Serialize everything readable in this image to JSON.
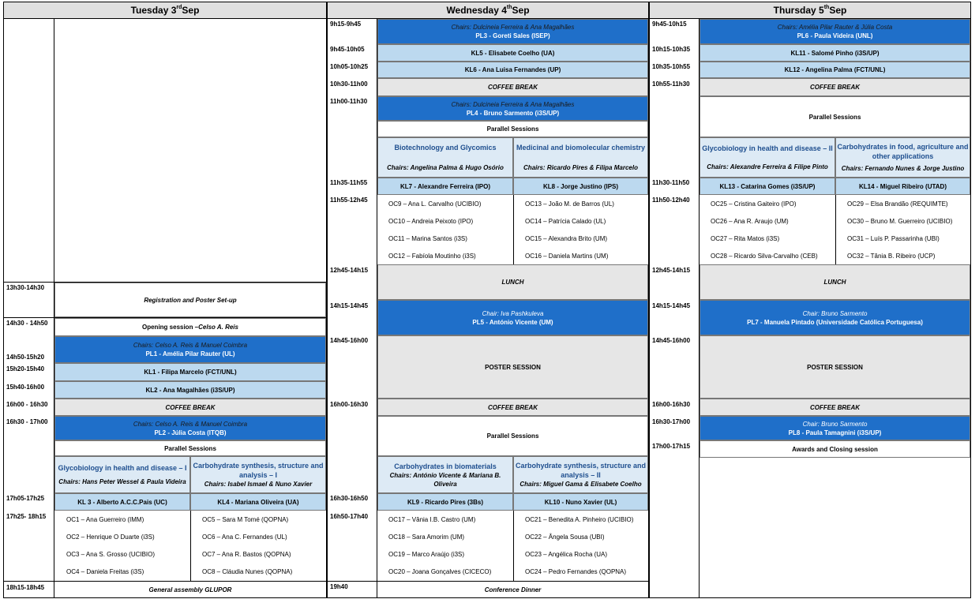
{
  "days": [
    {
      "name": "Tuesday 3",
      "sup": "rd",
      "rest": " Sep"
    },
    {
      "name": "Wednesday 4",
      "sup": "th",
      "rest": " Sep"
    },
    {
      "name": "Thursday 5",
      "sup": "th",
      "rest": " Sep"
    }
  ],
  "tue": {
    "times": [
      "13h30-14h30",
      "14h30 - 14h50",
      "14h50-15h20",
      "15h20-15h40",
      "15h40-16h00",
      "16h00 - 16h30",
      "16h30 - 17h00",
      "17h05-17h25",
      "17h25- 18h15",
      "18h15-18h45"
    ],
    "registration": "Registration and Poster Set-up",
    "opening_a": "Opening session – ",
    "opening_b": "Celso A. Reis",
    "pl1_chairs": "Chairs: Celso A. Reis & Manuel Coimbra",
    "pl1": "PL1 - Amélia Pilar Rauter (UL)",
    "kl1": "KL1 - Filipa Marcelo (FCT/UNL)",
    "kl2": "KL2 - Ana Magalhães (i3S/UP)",
    "coffee": "COFFEE BREAK",
    "pl2_chairs": "Chairs: Celso A. Reis & Manuel Coimbra",
    "pl2": "PL2 - Júlia Costa (ITQB)",
    "parallel": "Parallel Sessions",
    "s1_title": "Glycobiology in health and disease – I",
    "s1_chairs": "Chairs: Hans Peter Wessel & Paula Videira",
    "s2_title": "Carbohydrate synthesis, structure and analysis – I",
    "s2_chairs": "Chairs: Isabel Ismael & Nuno Xavier",
    "kl3": "KL 3 - Alberto A.C.C.Pais (UC)",
    "kl4": "KL4 - Mariana Oliveira (UA)",
    "oc_left": [
      "OC1 – Ana Guerreiro (IMM)",
      "OC2 – Henrique O Duarte (i3S)",
      "OC3 – Ana S. Grosso (UCIBIO)",
      "OC4 – Daniela Freitas (i3S)"
    ],
    "oc_right": [
      "OC5 – Sara M Tomé (QOPNA)",
      "OC6 – Ana C. Fernandes (UL)",
      "OC7 – Ana R. Bastos (QOPNA)",
      "OC8 – Cláudia Nunes (QOPNA)"
    ],
    "assembly": "General assembly GLUPOR"
  },
  "wed": {
    "times": [
      "9h15-9h45",
      "9h45-10h05",
      "10h05-10h25",
      "10h30-11h00",
      "11h00-11h30",
      "11h35-11h55",
      "11h55-12h45",
      "12h45-14h15",
      "14h15-14h45",
      "14h45-16h00",
      "16h00-16h30",
      "16h30-16h50",
      "16h50-17h40",
      "19h40"
    ],
    "pl3_chairs": "Chairs: Dulcineia Ferreira & Ana Magalhães",
    "pl3": "PL3 -  Goreti Sales (ISEP)",
    "kl5": "KL5 - Elisabete Coelho (UA)",
    "kl6": "KL6 - Ana Luisa Fernandes (UP)",
    "coffee": "COFFEE BREAK",
    "pl4_chairs": "Chairs: Dulcineia Ferreira & Ana Magalhães",
    "pl4": "PL4 -  Bruno Sarmento (i3S/UP)",
    "parallel": "Parallel Sessions",
    "s1_title": "Biotechnology and Glycomics",
    "s1_chairs": "Chairs: Angelina Palma & Hugo Osório",
    "s2_title": "Medicinal and biomolecular chemistry",
    "s2_chairs": "Chairs: Ricardo Pires & Filipa Marcelo",
    "kl7": "KL7 - Alexandre Ferreira (IPO)",
    "kl8": "KL8 - Jorge Justino (IPS)",
    "oc_left": [
      "OC9 – Ana L. Carvalho (UCIBIO)",
      "OC10 – Andreia Peixoto (IPO)",
      "OC11 – Marina Santos (i3S)",
      "OC12 – Fabíola Moutinho (i3S)"
    ],
    "oc_right": [
      "OC13 – João M. de Barros (UL)",
      "OC14 – Patrícia Calado (UL)",
      "OC15 – Alexandra Brito (UM)",
      "OC16 – Daniela Martins (UM)"
    ],
    "lunch": "LUNCH",
    "pl5_chairs": "Chair: Iva Pashkuleva",
    "pl5": "PL5 - António Vicente (UM)",
    "poster": "POSTER SESSION",
    "coffee2": "COFFEE BREAK",
    "parallel2": "Parallel Sessions",
    "s3_title": "Carbohydrates in biomaterials",
    "s3_chairs": "Chairs: António Vicente & Mariana B. Oliveira",
    "s4_title": "Carbohydrate synthesis, structure and analysis – II",
    "s4_chairs": "Chairs: Miguel Gama & Elisabete Coelho",
    "kl9": "KL9 - Ricardo Pires (3Bs)",
    "kl10": "KL10 -  Nuno Xavier (UL)",
    "oc_left2": [
      "OC17 – Vânia I.B. Castro (UM)",
      "OC18 – Sara Amorim (UM)",
      "OC19 – Marco Araújo (i3S)",
      "OC20 – Joana Gonçalves (CICECO)"
    ],
    "oc_right2": [
      "OC21 – Benedita A. Pinheiro (UCIBIO)",
      "OC22 – Ângela Sousa (UBI)",
      "OC23 – Angélica Rocha (UA)",
      "OC24 – Pedro Fernandes (QOPNA)"
    ],
    "dinner": "Conference Dinner"
  },
  "thu": {
    "times": [
      "9h45-10h15",
      "10h15-10h35",
      "10h35-10h55",
      "10h55-11h30",
      "11h30-11h50",
      "11h50-12h40",
      "12h45-14h15",
      "14h15-14h45",
      "14h45-16h00",
      "16h00-16h30",
      "16h30-17h00",
      "17h00-17h15"
    ],
    "pl6_chairs": "Chairs: Amélia Pilar Rauter & Júlia Costa",
    "pl6": "PL6 - Paula Videira (UNL)",
    "kl11": "KL11 - Salomé Pinho (i3S/UP)",
    "kl12": "KL12 - Angelina Palma (FCT/UNL)",
    "coffee": "COFFEE BREAK",
    "parallel": "Parallel Sessions",
    "s1_title": "Glycobiology in health and disease – II",
    "s1_chairs": "Chairs: Alexandre Ferreira & Filipe Pinto",
    "s2_title": "Carbohydrates in food, agriculture and other applications",
    "s2_chairs": "Chairs: Fernando Nunes  & Jorge Justino",
    "kl13": "KL13 - Catarina Gomes (i3S/UP)",
    "kl14": "KL14 - Miguel Ribeiro (UTAD)",
    "oc_left": [
      "OC25 – Cristina Gaiteiro (IPO)",
      "OC26 – Ana R. Araujo (UM)",
      "OC27 – Rita Matos (i3S)",
      "OC28 – Ricardo Silva-Carvalho (CEB)"
    ],
    "oc_right": [
      "OC29 – Elsa Brandão (REQUIMTE)",
      "OC30 – Bruno M. Guerreiro (UCIBIO)",
      "OC31 – Luís P. Passarinha (UBI)",
      "OC32 – Tânia B. Ribeiro (UCP)"
    ],
    "lunch": "LUNCH",
    "pl7_chairs": "Chair: Bruno Sarmento",
    "pl7": "PL7 - Manuela Pintado (Universidade Católica Portuguesa)",
    "poster": "POSTER SESSION",
    "coffee2": "COFFEE BREAK",
    "pl8_chairs": "Chair: Bruno Sarmento",
    "pl8": "PL8 - Paula Tamagnini (i3S/UP)",
    "closing": "Awards and Closing session"
  }
}
